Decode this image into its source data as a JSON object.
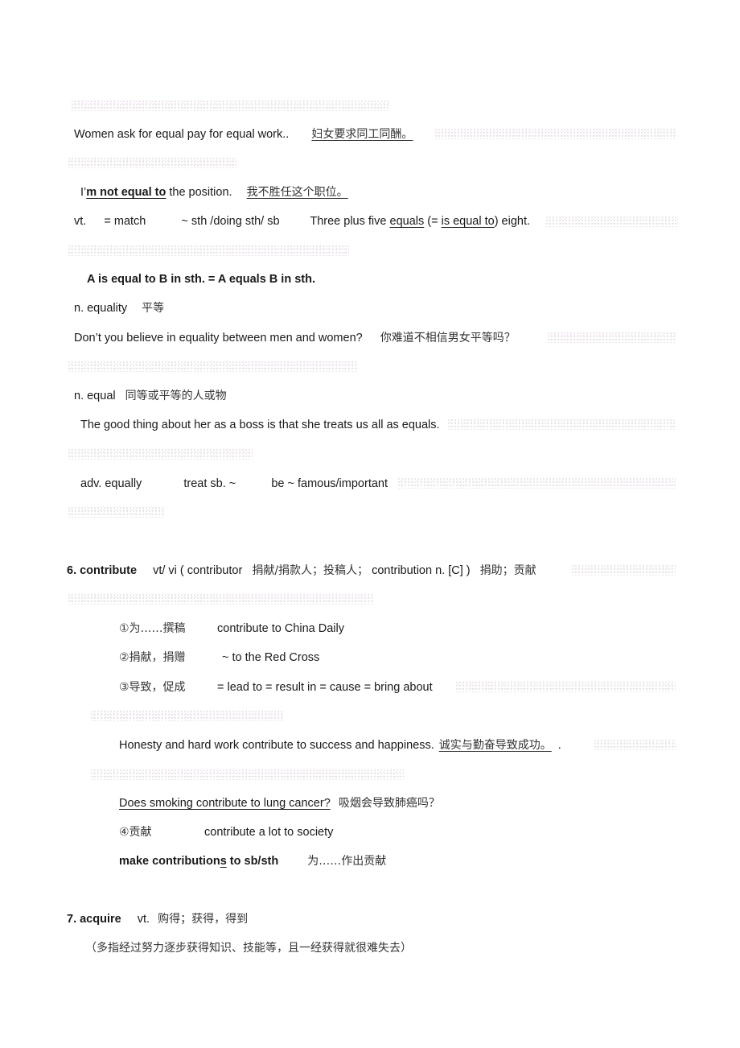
{
  "lines": {
    "l1_en": "Women ask for equal pay for equal work..",
    "l1_cn": "妇女要求同工同酬。",
    "l2_pre": "I’",
    "l2_bold": "m not equal to",
    "l2_rest": " the position.",
    "l2_cn": "我不胜任这个职位。",
    "l3_vt": "vt.",
    "l3_match": "= match",
    "l3_pattern": "~ sth /doing sth/ sb",
    "l3_ex_a": "Three plus five ",
    "l3_ex_u1": "equals",
    "l3_ex_b": " (= ",
    "l3_ex_u2": "is equal to",
    "l3_ex_c": ") eight.",
    "l4_bold": "A is equal to B in sth. = A equals B in sth.",
    "l5_en": "n. equality",
    "l5_cn": "平等",
    "l6_en": "Don’t you believe in equality between men and women?",
    "l6_cn": "你难道不相信男女平等吗？",
    "l7_en": "n. equal",
    "l7_cn": "同等或平等的人或物",
    "l8_en": "The good thing about her as a boss is that she treats us all as equals.",
    "l9_a": "adv. equally",
    "l9_b": "treat sb. ~",
    "l9_c": "be ~ famous/important"
  },
  "contribute": {
    "heading": "6. contribute",
    "pos": "vt/ vi ( contributor",
    "cn1": "捐献/捐款人；投稿人；",
    "contribution": "contribution n. [C] )",
    "cn2": "捐助；贡献",
    "s1_cn": "①为……撰稿",
    "s1_en": "contribute to China Daily",
    "s2_cn": "②捐献，捐赠",
    "s2_en": "~ to the Red Cross",
    "s3_cn": "③导致，促成",
    "s3_en": "= lead to = result in = cause = bring about",
    "ex1_en": "Honesty and hard work contribute to success and happiness.",
    "ex1_cn": "诚实与勤奋导致成功。",
    "ex1_end": ".",
    "ex2_en": "Does smoking contribute to lung cancer?",
    "ex2_cn": "吸烟会导致肺癌吗？",
    "s4_cn": "④贡献",
    "s4_en": "contribute a lot to society",
    "phrase_a": "make contribution",
    "phrase_s": "s",
    "phrase_b": " to sb/sth",
    "phrase_cn": "为……作出贡献"
  },
  "acquire": {
    "heading": "7. acquire",
    "pos": "vt.",
    "cn": "购得；获得，得到",
    "note": "（多指经过努力逐步获得知识、技能等，且一经获得就很难失去）"
  }
}
